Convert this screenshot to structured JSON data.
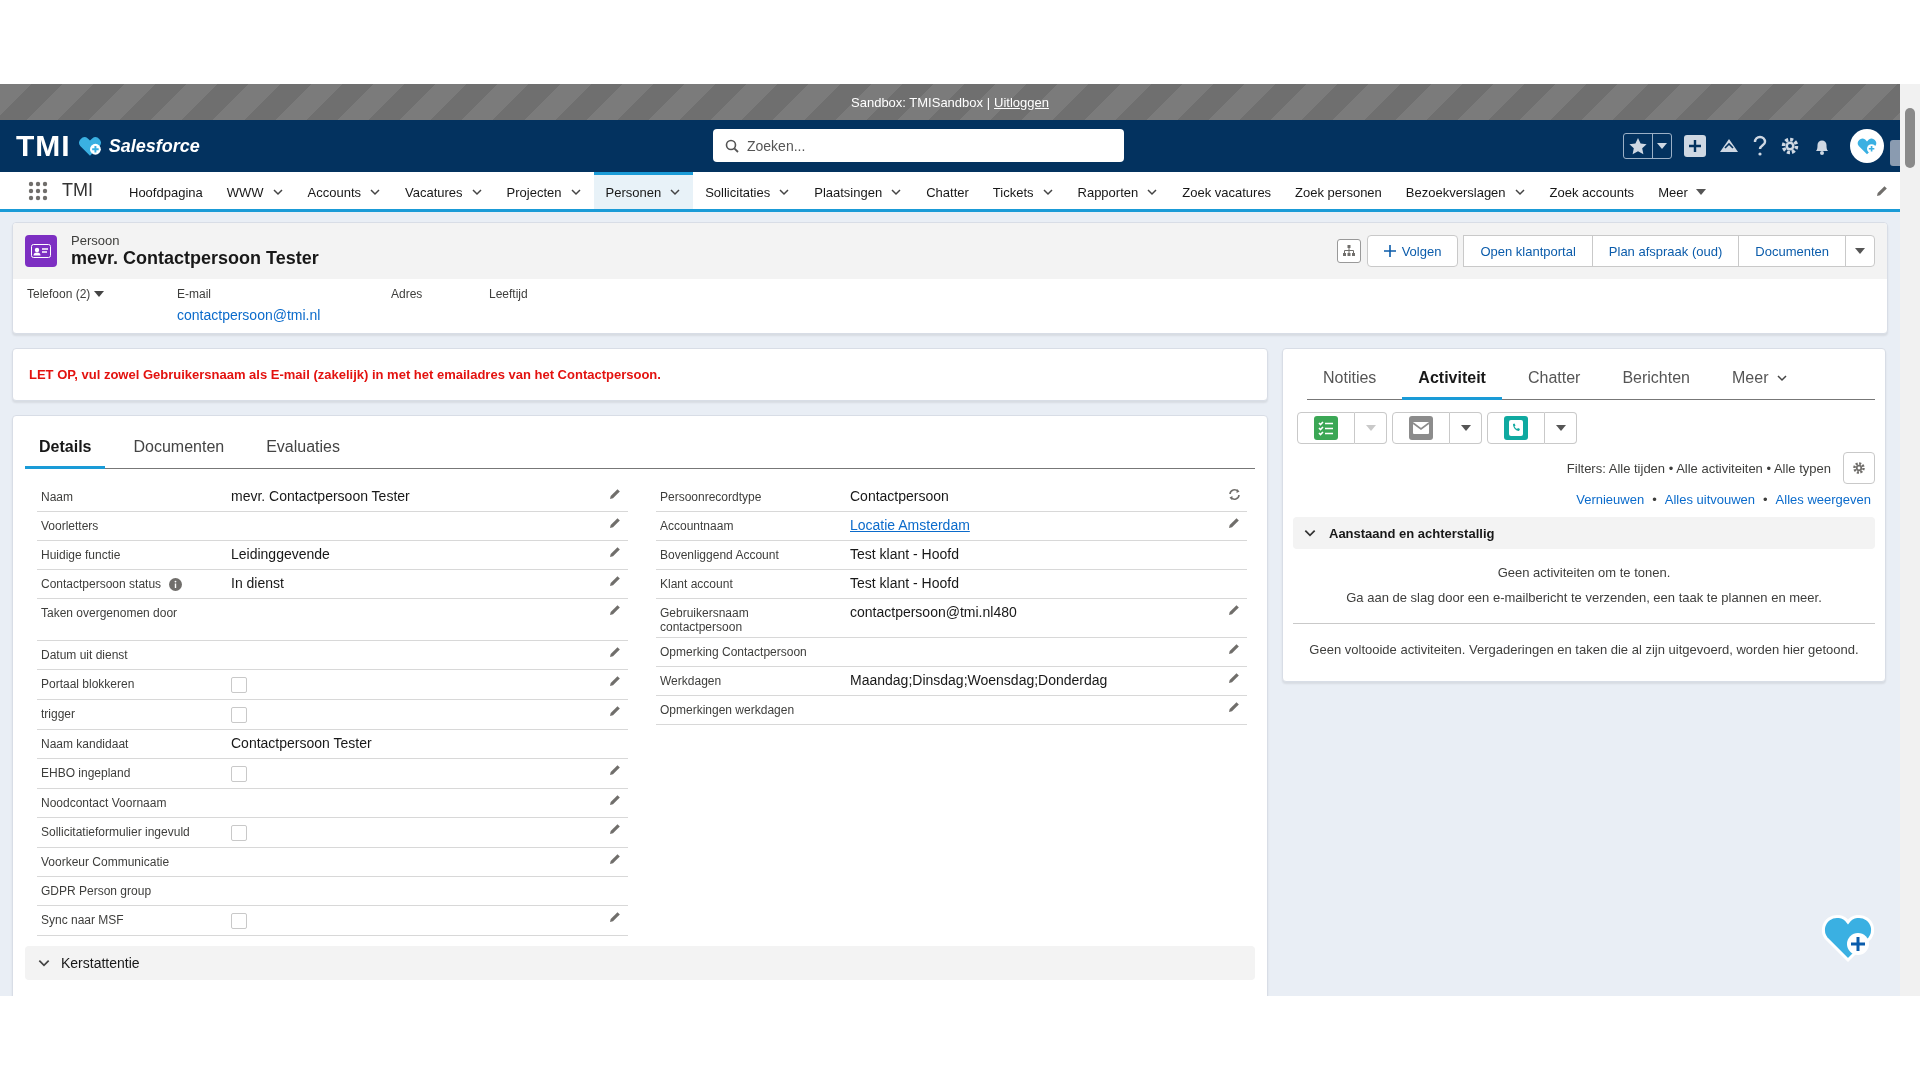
{
  "sandbox_bar": {
    "text": "Sandbox: TMISandbox |",
    "link": "Uitloggen"
  },
  "header": {
    "logo": "TMI",
    "product": "Salesforce",
    "search": {
      "placeholder": "Zoeken..."
    }
  },
  "nav": {
    "app_name": "TMI",
    "items": [
      {
        "label": "Hoofdpagina",
        "kind": "plain",
        "selected": false
      },
      {
        "label": "WWW",
        "kind": "menu",
        "selected": false
      },
      {
        "label": "Accounts",
        "kind": "menu",
        "selected": false
      },
      {
        "label": "Vacatures",
        "kind": "menu",
        "selected": false
      },
      {
        "label": "Projecten",
        "kind": "menu",
        "selected": false
      },
      {
        "label": "Personen",
        "kind": "menu",
        "selected": true
      },
      {
        "label": "Sollicitaties",
        "kind": "menu",
        "selected": false
      },
      {
        "label": "Plaatsingen",
        "kind": "menu",
        "selected": false
      },
      {
        "label": "Chatter",
        "kind": "plain",
        "selected": false
      },
      {
        "label": "Tickets",
        "kind": "menu",
        "selected": false
      },
      {
        "label": "Rapporten",
        "kind": "menu",
        "selected": false
      },
      {
        "label": "Zoek vacatures",
        "kind": "plain",
        "selected": false
      },
      {
        "label": "Zoek personen",
        "kind": "plain",
        "selected": false
      },
      {
        "label": "Bezoekverslagen",
        "kind": "menu",
        "selected": false
      },
      {
        "label": "Zoek accounts",
        "kind": "plain",
        "selected": false
      },
      {
        "label": "Meer",
        "kind": "more",
        "selected": false
      }
    ]
  },
  "record": {
    "type": "Persoon",
    "name": "mevr. Contactpersoon Tester",
    "buttons": [
      {
        "label": "Volgen",
        "kind": "follow"
      },
      {
        "label": "Open klantportal",
        "kind": "plain"
      },
      {
        "label": "Plan afspraak (oud)",
        "kind": "plain"
      },
      {
        "label": "Documenten",
        "kind": "plain"
      }
    ],
    "highlights": [
      {
        "label": "Telefoon (2)",
        "kind": "dropdown"
      },
      {
        "label": "E-mail",
        "value": "contactpersoon@tmi.nl",
        "kind": "link"
      },
      {
        "label": "Adres",
        "kind": "label"
      },
      {
        "label": "Leeftijd",
        "kind": "label"
      }
    ]
  },
  "warning": "LET OP, vul zowel Gebruikersnaam als E-mail (zakelijk) in met het emailadres van het Contactpersoon.",
  "detail_tabs": [
    {
      "label": "Details",
      "selected": true
    },
    {
      "label": "Documenten",
      "selected": false
    },
    {
      "label": "Evaluaties",
      "selected": false
    }
  ],
  "fields_left": [
    {
      "label": "Naam",
      "kind": "text",
      "value": "mevr. Contactpersoon Tester",
      "editable": true
    },
    {
      "label": "Voorletters",
      "kind": "text",
      "editable": true
    },
    {
      "label": "Huidige functie",
      "kind": "text",
      "value": "Leidinggevende",
      "editable": true
    },
    {
      "label": "Contactpersoon status",
      "kind": "text",
      "value": "In dienst",
      "info": true,
      "editable": true
    },
    {
      "label": "Taken overgenomen door",
      "kind": "text",
      "editable": true,
      "tall": true
    },
    {
      "label": "Datum uit dienst",
      "kind": "text",
      "editable": true
    },
    {
      "label": "Portaal blokkeren",
      "kind": "checkbox",
      "checked": false,
      "editable": true
    },
    {
      "label": "trigger",
      "kind": "checkbox",
      "checked": false,
      "editable": true
    },
    {
      "label": "Naam kandidaat",
      "kind": "text",
      "value": "Contactpersoon Tester",
      "editable": false
    },
    {
      "label": "EHBO ingepland",
      "kind": "checkbox",
      "checked": false,
      "editable": true
    },
    {
      "label": "Noodcontact Voornaam",
      "kind": "text",
      "editable": true
    },
    {
      "label": "Sollicitatieformulier ingevuld",
      "kind": "checkbox",
      "checked": false,
      "editable": true
    },
    {
      "label": "Voorkeur Communicatie",
      "kind": "text",
      "editable": true
    },
    {
      "label": "GDPR Person group",
      "kind": "text",
      "editable": false
    },
    {
      "label": "Sync naar MSF",
      "kind": "checkbox",
      "checked": false,
      "editable": true
    }
  ],
  "fields_right": [
    {
      "label": "Persoonrecordtype",
      "kind": "text",
      "value": "Contactpersoon",
      "editable": false,
      "changeable": true
    },
    {
      "label": "Accountnaam",
      "kind": "link",
      "value": "Locatie Amsterdam",
      "editable": true
    },
    {
      "label": "Bovenliggend Account",
      "kind": "text",
      "value": "Test klant - Hoofd",
      "editable": false
    },
    {
      "label": "Klant account",
      "kind": "text",
      "value": "Test klant - Hoofd",
      "editable": false
    },
    {
      "label": "Gebruikersnaam contactpersoon",
      "kind": "text",
      "value": "contactpersoon@tmi.nl480",
      "editable": true
    },
    {
      "label": "Opmerking Contactpersoon",
      "kind": "text",
      "editable": true
    },
    {
      "label": "Werkdagen",
      "kind": "text",
      "value": "Maandag;Dinsdag;Woensdag;Donderdag",
      "editable": true
    },
    {
      "label": "Opmerkingen werkdagen",
      "kind": "text",
      "editable": true
    }
  ],
  "sections": [
    {
      "title": "Kerstattentie",
      "expanded": true
    }
  ],
  "activity": {
    "tabs": [
      {
        "label": "Notities",
        "selected": false,
        "kind": "plain"
      },
      {
        "label": "Activiteit",
        "selected": true,
        "kind": "plain"
      },
      {
        "label": "Chatter",
        "selected": false,
        "kind": "plain"
      },
      {
        "label": "Berichten",
        "selected": false,
        "kind": "plain"
      },
      {
        "label": "Meer",
        "selected": false,
        "kind": "menu"
      }
    ],
    "actions": [
      {
        "kind": "task",
        "menu_disabled": true
      },
      {
        "kind": "email",
        "menu_disabled": false
      },
      {
        "kind": "call",
        "menu_disabled": false
      }
    ],
    "filters": "Filters: Alle tijden • Alle activiteiten • Alle typen",
    "links": [
      "Vernieuwen",
      "Alles uitvouwen",
      "Alles weergeven"
    ],
    "link_separator": "•",
    "upcoming": {
      "title": "Aanstaand en achterstallig",
      "expanded": true,
      "empty_lines": [
        "Geen activiteiten om te tonen.",
        "Ga aan de slag door een e-mailbericht te verzenden, een taak te plannen en meer."
      ]
    },
    "past_empty": "Geen voltooide activiteiten. Vergaderingen en taken die al zijn uitgevoerd, worden hier getoond."
  }
}
